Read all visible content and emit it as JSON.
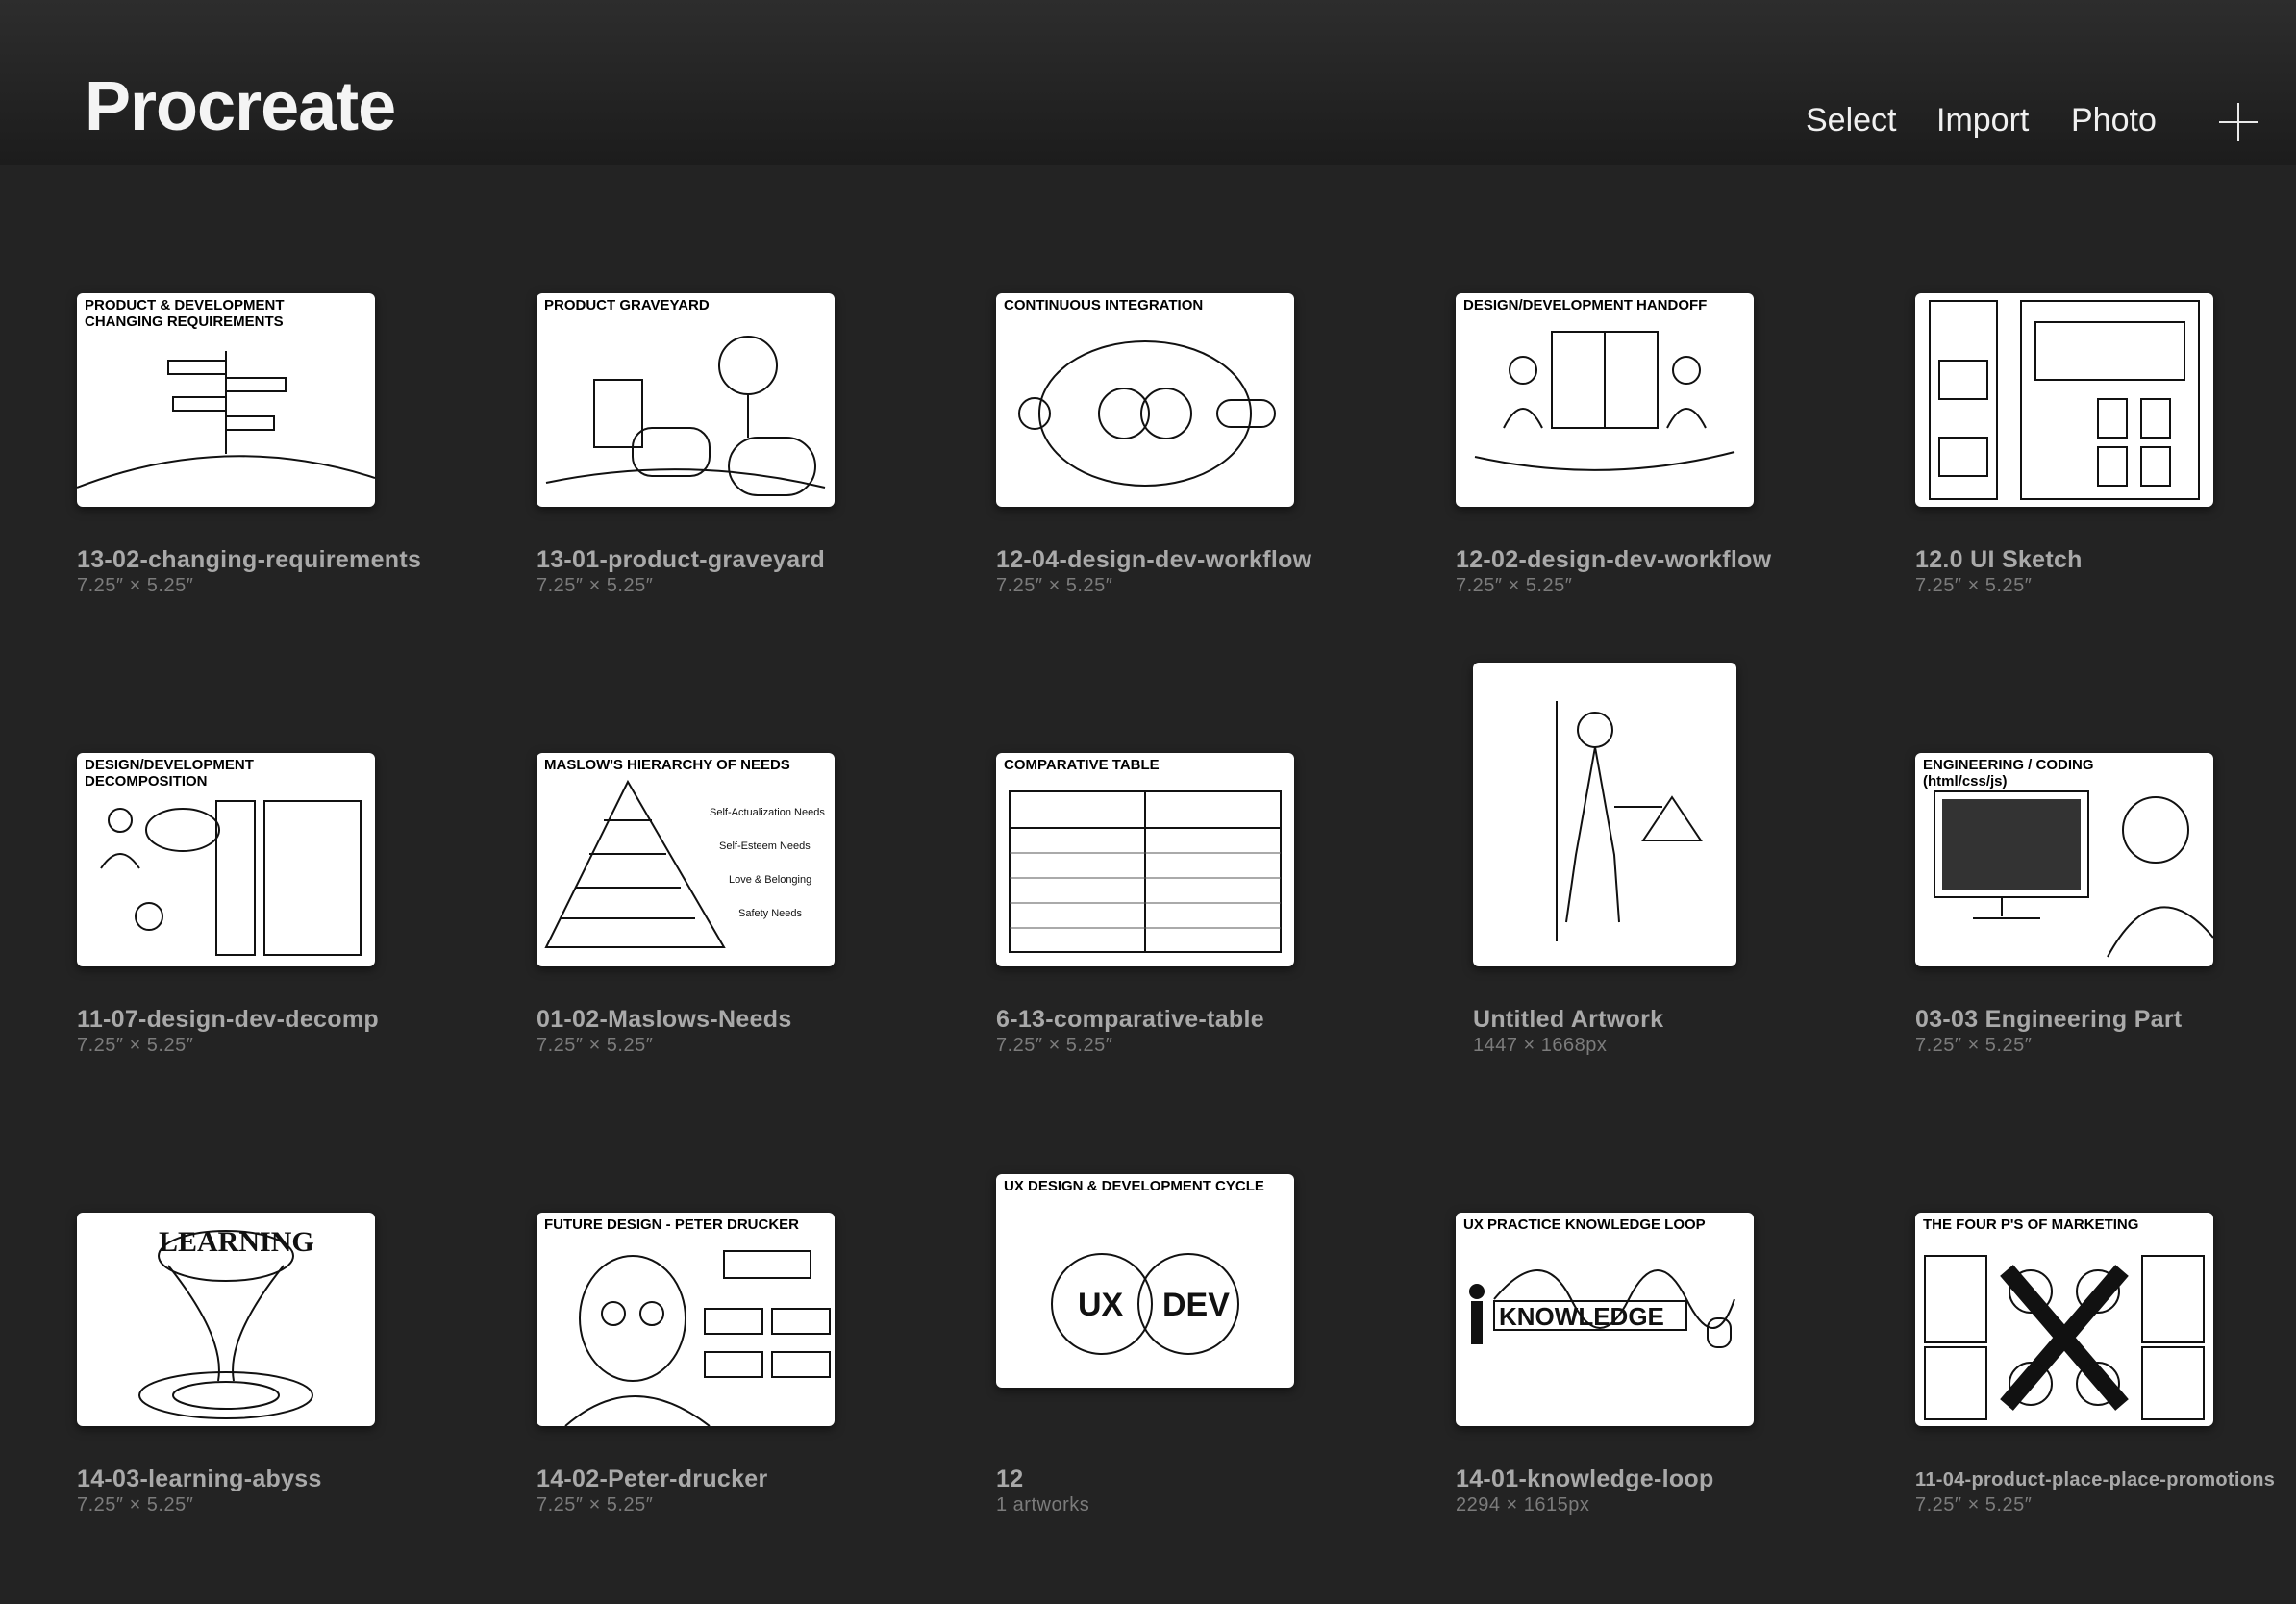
{
  "app": {
    "title": "Procreate"
  },
  "toolbar": {
    "select_label": "Select",
    "import_label": "Import",
    "photo_label": "Photo"
  },
  "gallery": [
    {
      "name": "13-02-changing-requirements",
      "size": "7.25″ × 5.25″",
      "thumb_title": "PRODUCT & DEVELOPMENT\nCHANGING REQUIREMENTS",
      "icon": "signpost-icon"
    },
    {
      "name": "13-01-product-graveyard",
      "size": "7.25″ × 5.25″",
      "thumb_title": "PRODUCT GRAVEYARD",
      "icon": "graveyard-icon"
    },
    {
      "name": "12-04-design-dev-workflow",
      "size": "7.25″ × 5.25″",
      "thumb_title": "CONTINUOUS INTEGRATION",
      "icon": "loop-icon"
    },
    {
      "name": "12-02-design-dev-workflow",
      "size": "7.25″ × 5.25″",
      "thumb_title": "DESIGN/DEVELOPMENT HANDOFF",
      "icon": "handoff-icon"
    },
    {
      "name": "12.0 UI Sketch",
      "size": "7.25″ × 5.25″",
      "thumb_title": "",
      "icon": "wireframe-icon"
    },
    {
      "name": "11-07-design-dev-decomp",
      "size": "7.25″ × 5.25″",
      "thumb_title": "DESIGN/DEVELOPMENT DECOMPOSITION",
      "icon": "decomposition-icon"
    },
    {
      "name": "01-02-Maslows-Needs",
      "size": "7.25″ × 5.25″",
      "thumb_title": "MASLOW'S HIERARCHY OF NEEDS",
      "icon": "pyramid-icon"
    },
    {
      "name": "6-13-comparative-table",
      "size": "7.25″ × 5.25″",
      "thumb_title": "COMPARATIVE TABLE",
      "icon": "table-icon"
    },
    {
      "name": "Untitled Artwork",
      "size": "1447 × 1668px",
      "thumb_title": "",
      "icon": "figure-icon"
    },
    {
      "name": "03-03 Engineering Part",
      "size": "7.25″ × 5.25″",
      "thumb_title": "ENGINEERING / CODING\n(html/css/js)",
      "icon": "coder-icon"
    },
    {
      "name": "14-03-learning-abyss",
      "size": "7.25″ × 5.25″",
      "thumb_title": "",
      "icon": "abyss-icon"
    },
    {
      "name": "14-02-Peter-drucker",
      "size": "7.25″ × 5.25″",
      "thumb_title": "FUTURE DESIGN - PETER DRUCKER",
      "icon": "portrait-icon"
    },
    {
      "name": "12",
      "size": "1 artworks",
      "thumb_title": "UX DESIGN & DEVELOPMENT CYCLE",
      "icon": "stack-icon"
    },
    {
      "name": "14-01-knowledge-loop",
      "size": "2294 × 1615px",
      "thumb_title": "UX PRACTICE KNOWLEDGE LOOP",
      "icon": "knowledge-loop-icon"
    },
    {
      "name": "11-04-product-place-place-promotions",
      "size": "7.25″ × 5.25″",
      "thumb_title": "THE FOUR P'S OF MARKETING",
      "icon": "marketing-icon"
    }
  ]
}
